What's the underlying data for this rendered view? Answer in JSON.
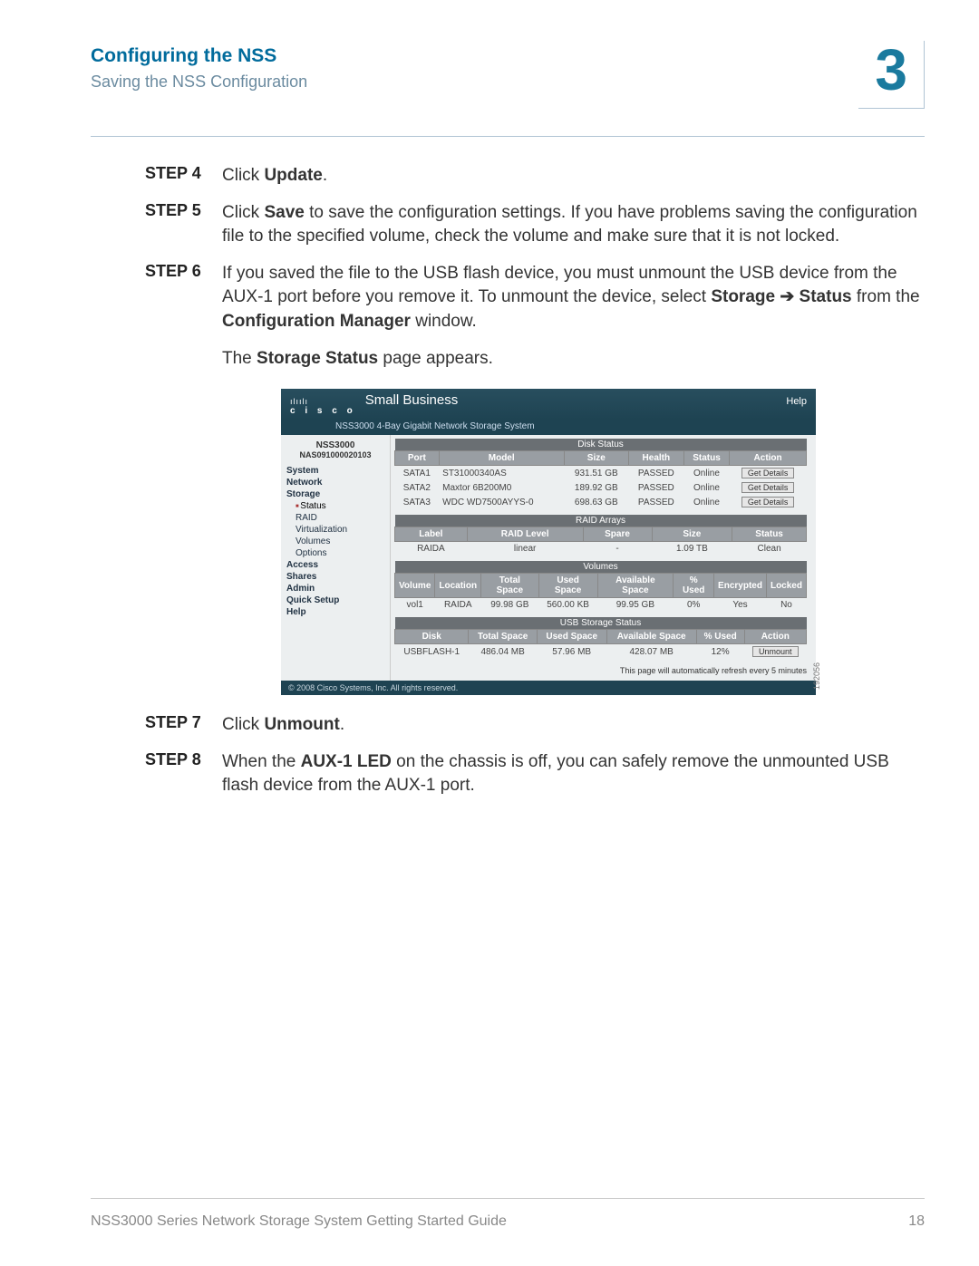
{
  "header": {
    "title": "Configuring the NSS",
    "subtitle": "Saving the NSS Configuration",
    "chapter": "3"
  },
  "steps": {
    "s4": {
      "label": "STEP 4",
      "text_a": "Click ",
      "bold_a": "Update",
      "text_b": "."
    },
    "s5": {
      "label": "STEP 5",
      "text_a": "Click ",
      "bold_a": "Save",
      "text_b": " to save the configuration settings. If you have problems saving the configuration file to the specified volume, check the volume and make sure that it is not locked."
    },
    "s6": {
      "label": "STEP 6",
      "text_a": "If you saved the file to the USB flash device, you must unmount the USB device from the AUX-1 port before you remove it. To unmount the device, select ",
      "bold_a": "Storage ➔ Status",
      "text_b": " from the ",
      "bold_b": "Configuration Manager",
      "text_c": " window.",
      "sub_a": "The ",
      "sub_bold": "Storage Status",
      "sub_b": " page appears."
    },
    "s7": {
      "label": "STEP 7",
      "text_a": "Click ",
      "bold_a": "Unmount",
      "text_b": "."
    },
    "s8": {
      "label": "STEP 8",
      "text_a": "When the ",
      "bold_a": "AUX-1 LED",
      "text_b": " on the chassis is off, you can safely remove the unmounted USB flash device from the AUX-1 port."
    }
  },
  "screenshot": {
    "brand_cisco": "c i s c o",
    "brand_small": "Small Business",
    "help": "Help",
    "product": "NSS3000 4-Bay Gigabit Network Storage System",
    "dev_name": "NSS3000",
    "dev_id": "NAS091000020103",
    "nav": [
      "System",
      "Network",
      "Storage",
      "Status",
      "RAID",
      "Virtualization",
      "Volumes",
      "Options",
      "Access",
      "Shares",
      "Admin",
      "Quick Setup",
      "Help"
    ],
    "disk": {
      "title": "Disk Status",
      "headers": [
        "Port",
        "Model",
        "Size",
        "Health",
        "Status",
        "Action"
      ],
      "rows": [
        [
          "SATA1",
          "ST31000340AS",
          "931.51 GB",
          "PASSED",
          "Online",
          "Get Details"
        ],
        [
          "SATA2",
          "Maxtor 6B200M0",
          "189.92 GB",
          "PASSED",
          "Online",
          "Get Details"
        ],
        [
          "SATA3",
          "WDC WD7500AYYS-0",
          "698.63 GB",
          "PASSED",
          "Online",
          "Get Details"
        ]
      ]
    },
    "raid": {
      "title": "RAID Arrays",
      "headers": [
        "Label",
        "RAID Level",
        "Spare",
        "Size",
        "Status"
      ],
      "rows": [
        [
          "RAIDA",
          "linear",
          "-",
          "1.09 TB",
          "Clean"
        ]
      ]
    },
    "volumes": {
      "title": "Volumes",
      "headers": [
        "Volume",
        "Location",
        "Total Space",
        "Used Space",
        "Available Space",
        "% Used",
        "Encrypted",
        "Locked"
      ],
      "rows": [
        [
          "vol1",
          "RAIDA",
          "99.98 GB",
          "560.00 KB",
          "99.95 GB",
          "0%",
          "Yes",
          "No"
        ]
      ]
    },
    "usb": {
      "title": "USB Storage Status",
      "headers": [
        "Disk",
        "Total Space",
        "Used Space",
        "Available Space",
        "% Used",
        "Action"
      ],
      "rows": [
        [
          "USBFLASH-1",
          "486.04 MB",
          "57.96 MB",
          "428.07 MB",
          "12%",
          "Unmount"
        ]
      ]
    },
    "refresh_note": "This page will automatically refresh every 5 minutes",
    "copyright": "© 2008 Cisco Systems, Inc. All rights reserved.",
    "image_id": "192056"
  },
  "footer": {
    "doc_title": "NSS3000 Series Network Storage System Getting Started Guide",
    "page": "18"
  }
}
